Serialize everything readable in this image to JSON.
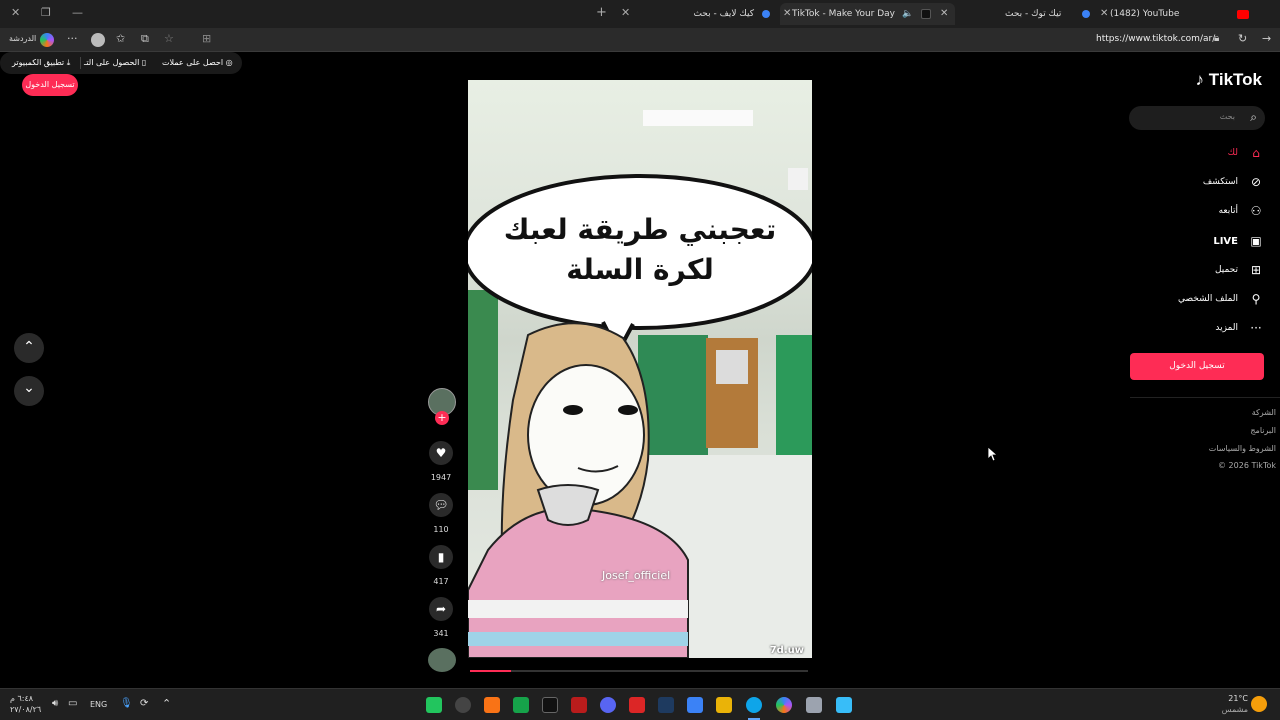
{
  "tabs": [
    {
      "title": "(1482) YouTube"
    },
    {
      "title": "تيك توك - بحث"
    },
    {
      "title": "TikTok - Make Your Day"
    },
    {
      "title": "كيك لايف - بحث"
    }
  ],
  "address": {
    "url": "https://www.tiktok.com/ar/",
    "profile_label": "الدردشة"
  },
  "top_bar": {
    "login": "تسجيل الدخول",
    "desktop_app": "تطبيق الكمبيوتر",
    "get_app": "الحصول على التـ",
    "coins": "احصل على عملات"
  },
  "sidebar": {
    "logo": "TikTok",
    "search_placeholder": "بحث",
    "items": [
      {
        "label": "لك",
        "icon": "home-icon"
      },
      {
        "label": "استكشف",
        "icon": "explore-icon"
      },
      {
        "label": "أتابعه",
        "icon": "following-icon"
      },
      {
        "label": "LIVE",
        "icon": "live-icon"
      },
      {
        "label": "تحميل",
        "icon": "upload-icon"
      },
      {
        "label": "الملف الشخصي",
        "icon": "profile-icon"
      },
      {
        "label": "المزيد",
        "icon": "more-icon"
      }
    ],
    "login": "تسجيل الدخول",
    "footer": [
      "الشركة",
      "البرنامج",
      "الشروط والسياسات",
      "© 2026 TikTok"
    ]
  },
  "video": {
    "caption_line1": "تعجبني طريقة لعبك",
    "caption_line2": "لكرة السلة",
    "watermark": "Josef_officiel",
    "corner_tag": "7d.uw",
    "progress": 0.12
  },
  "actions": {
    "likes": "1947",
    "comments": "110",
    "saves": "417",
    "shares": "341"
  },
  "taskbar": {
    "clock_time": "٦:٤٨ م",
    "clock_date": "٢٧/٠٨/٢٦",
    "language": "ENG",
    "weather_temp": "21°C",
    "weather_desc": "مشمس"
  },
  "colors": {
    "accent": "#fe2c55",
    "background": "#000000"
  }
}
